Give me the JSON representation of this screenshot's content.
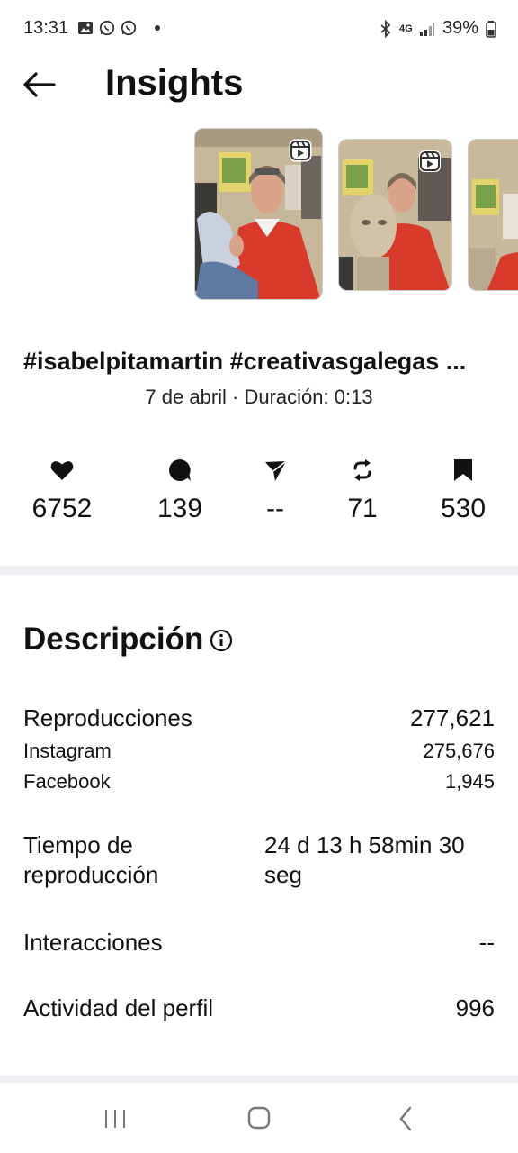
{
  "status_bar": {
    "time": "13:31",
    "network": "4G",
    "battery": "39%",
    "icons": [
      "gallery-icon",
      "whatsapp-icon",
      "whatsapp-icon",
      "bluetooth-icon",
      "signal-icon",
      "battery-icon"
    ]
  },
  "header": {
    "title": "Insights",
    "back_icon": "arrow-left-icon"
  },
  "thumbnails": [
    {
      "type": "reel",
      "icon": "reel-icon"
    },
    {
      "type": "reel",
      "icon": "reel-icon"
    },
    {
      "type": "reel",
      "icon": "reel-icon"
    }
  ],
  "post": {
    "caption": "#isabelpitamartin #creativasgalegas ...",
    "meta": "7 de abril · Duración: 0:13"
  },
  "stats": [
    {
      "icon": "heart-icon",
      "value": "6752"
    },
    {
      "icon": "comment-icon",
      "value": "139"
    },
    {
      "icon": "share-icon",
      "value": "--"
    },
    {
      "icon": "repost-icon",
      "value": "71"
    },
    {
      "icon": "bookmark-icon",
      "value": "530"
    }
  ],
  "description": {
    "title": "Descripción",
    "plays_label": "Reproducciones",
    "plays_value": "277,621",
    "instagram_label": "Instagram",
    "instagram_value": "275,676",
    "facebook_label": "Facebook",
    "facebook_value": "1,945",
    "watch_time_label": "Tiempo de reproducción",
    "watch_time_value": "24 d 13 h 58min 30 seg",
    "interactions_label": "Interacciones",
    "interactions_value": "--",
    "profile_activity_label": "Actividad del perfil",
    "profile_activity_value": "996"
  },
  "nav": {
    "icons": [
      "recents-icon",
      "home-icon",
      "back-icon"
    ]
  },
  "colors": {
    "divider": "#eef0f3",
    "text": "#111111",
    "jacket": "#d83a2b"
  }
}
